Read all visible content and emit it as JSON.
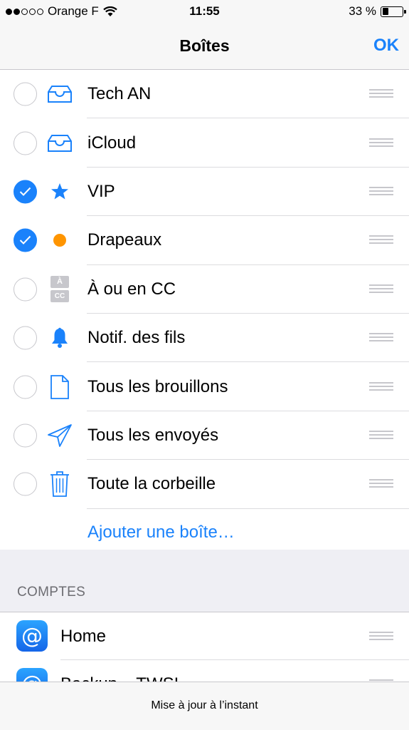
{
  "status_bar": {
    "carrier": "Orange F",
    "time": "11:55",
    "battery_text": "33 %",
    "battery_level": 0.33
  },
  "nav": {
    "title": "Boîtes",
    "done_label": "OK"
  },
  "mailboxes": [
    {
      "label": "Tech AN",
      "checked": false,
      "icon": "inbox-icon"
    },
    {
      "label": "iCloud",
      "checked": false,
      "icon": "inbox-icon"
    },
    {
      "label": "VIP",
      "checked": true,
      "icon": "star-icon"
    },
    {
      "label": "Drapeaux",
      "checked": true,
      "icon": "flag-dot-icon"
    },
    {
      "label": "À ou en CC",
      "checked": false,
      "icon": "to-cc-icon"
    },
    {
      "label": "Notif. des fils",
      "checked": false,
      "icon": "bell-icon"
    },
    {
      "label": "Tous les brouillons",
      "checked": false,
      "icon": "draft-icon"
    },
    {
      "label": "Tous les envoyés",
      "checked": false,
      "icon": "sent-icon"
    },
    {
      "label": "Toute la corbeille",
      "checked": false,
      "icon": "trash-icon"
    }
  ],
  "add_mailbox_label": "Ajouter une boîte…",
  "icon_text": {
    "to_cc_a": "À",
    "to_cc_cc": "CC"
  },
  "accounts_section": {
    "title": "COMPTES",
    "accounts": [
      {
        "label": "Home",
        "icon": "at-icon",
        "icon_glyph": "@"
      },
      {
        "label": "Backup – TWSI",
        "icon": "at-icon",
        "icon_glyph": "@"
      }
    ]
  },
  "toolbar": {
    "status": "Mise à jour à l’instant"
  },
  "colors": {
    "accent": "#1a82fb",
    "flag": "#ff9500",
    "separator": "#c8c7cc"
  }
}
